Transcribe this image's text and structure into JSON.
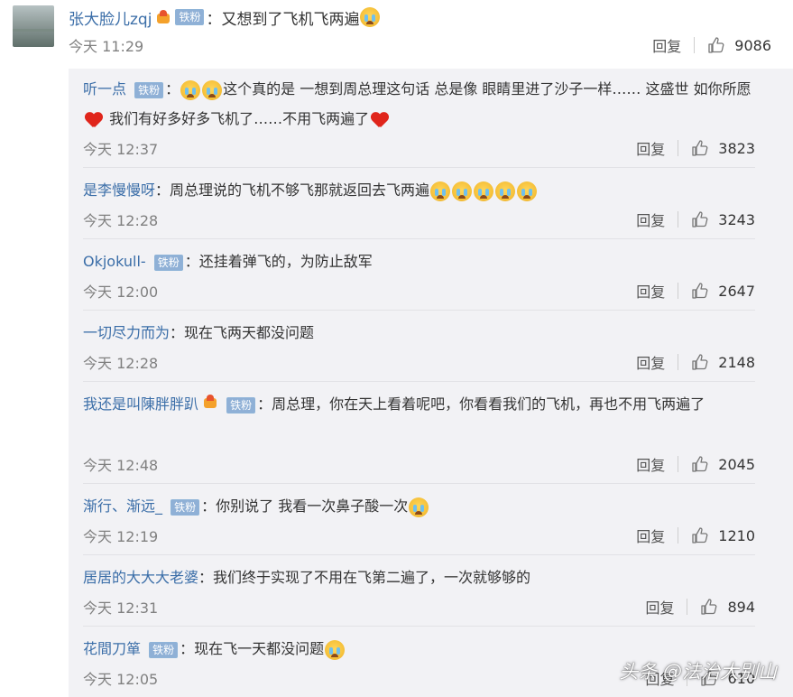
{
  "main_comment": {
    "username": "张大脸儿zqj",
    "badge": "铁粉",
    "text": "又想到了飞机飞两遍",
    "time": "今天 11:29",
    "reply_label": "回复",
    "likes": "9086"
  },
  "replies": [
    {
      "username": "听一点",
      "badge": "铁粉",
      "text_a": "这个真的是 一想到周总理这句话 总是像 眼睛里进了沙子一样…… 这盛世 如你所愿",
      "text_b": " 我们有好多好多飞机了……不用飞两遍了",
      "time": "今天 12:37",
      "reply_label": "回复",
      "likes": "3823"
    },
    {
      "username": "是李慢慢呀",
      "text": "周总理说的飞机不够飞那就返回去飞两遍",
      "time": "今天 12:28",
      "reply_label": "回复",
      "likes": "3243"
    },
    {
      "username": "Okjokull-",
      "badge": "铁粉",
      "text": "还挂着弹飞的，为防止敌军",
      "time": "今天 12:00",
      "reply_label": "回复",
      "likes": "2647"
    },
    {
      "username": "一切尽力而为",
      "text": "现在飞两天都没问题",
      "time": "今天 12:28",
      "reply_label": "回复",
      "likes": "2148"
    },
    {
      "username": "我还是叫陳胖胖趴",
      "badge": "铁粉",
      "text": "周总理，你在天上看着呢吧，你看看我们的飞机，再也不用飞两遍了",
      "time": "今天 12:48",
      "reply_label": "回复",
      "likes": "2045"
    },
    {
      "username": "渐行、渐远_",
      "badge": "铁粉",
      "text": "你别说了 我看一次鼻子酸一次",
      "time": "今天 12:19",
      "reply_label": "回复",
      "likes": "1210"
    },
    {
      "username": "居居的大大大老婆",
      "text": "我们终于实现了不用在飞第二遍了，一次就够够的",
      "time": "今天 12:31",
      "reply_label": "回复",
      "likes": "894"
    },
    {
      "username": "花間刀箪",
      "badge": "铁粉",
      "text": "现在飞一天都没问题",
      "time": "今天 12:05",
      "reply_label": "回复",
      "likes": "610"
    }
  ],
  "watermark": "头条 @法治大别山",
  "colors": {
    "username": "#3b6ea8",
    "badge_bg": "#8fb0d6",
    "reply_panel_bg": "#f2f2f5"
  }
}
